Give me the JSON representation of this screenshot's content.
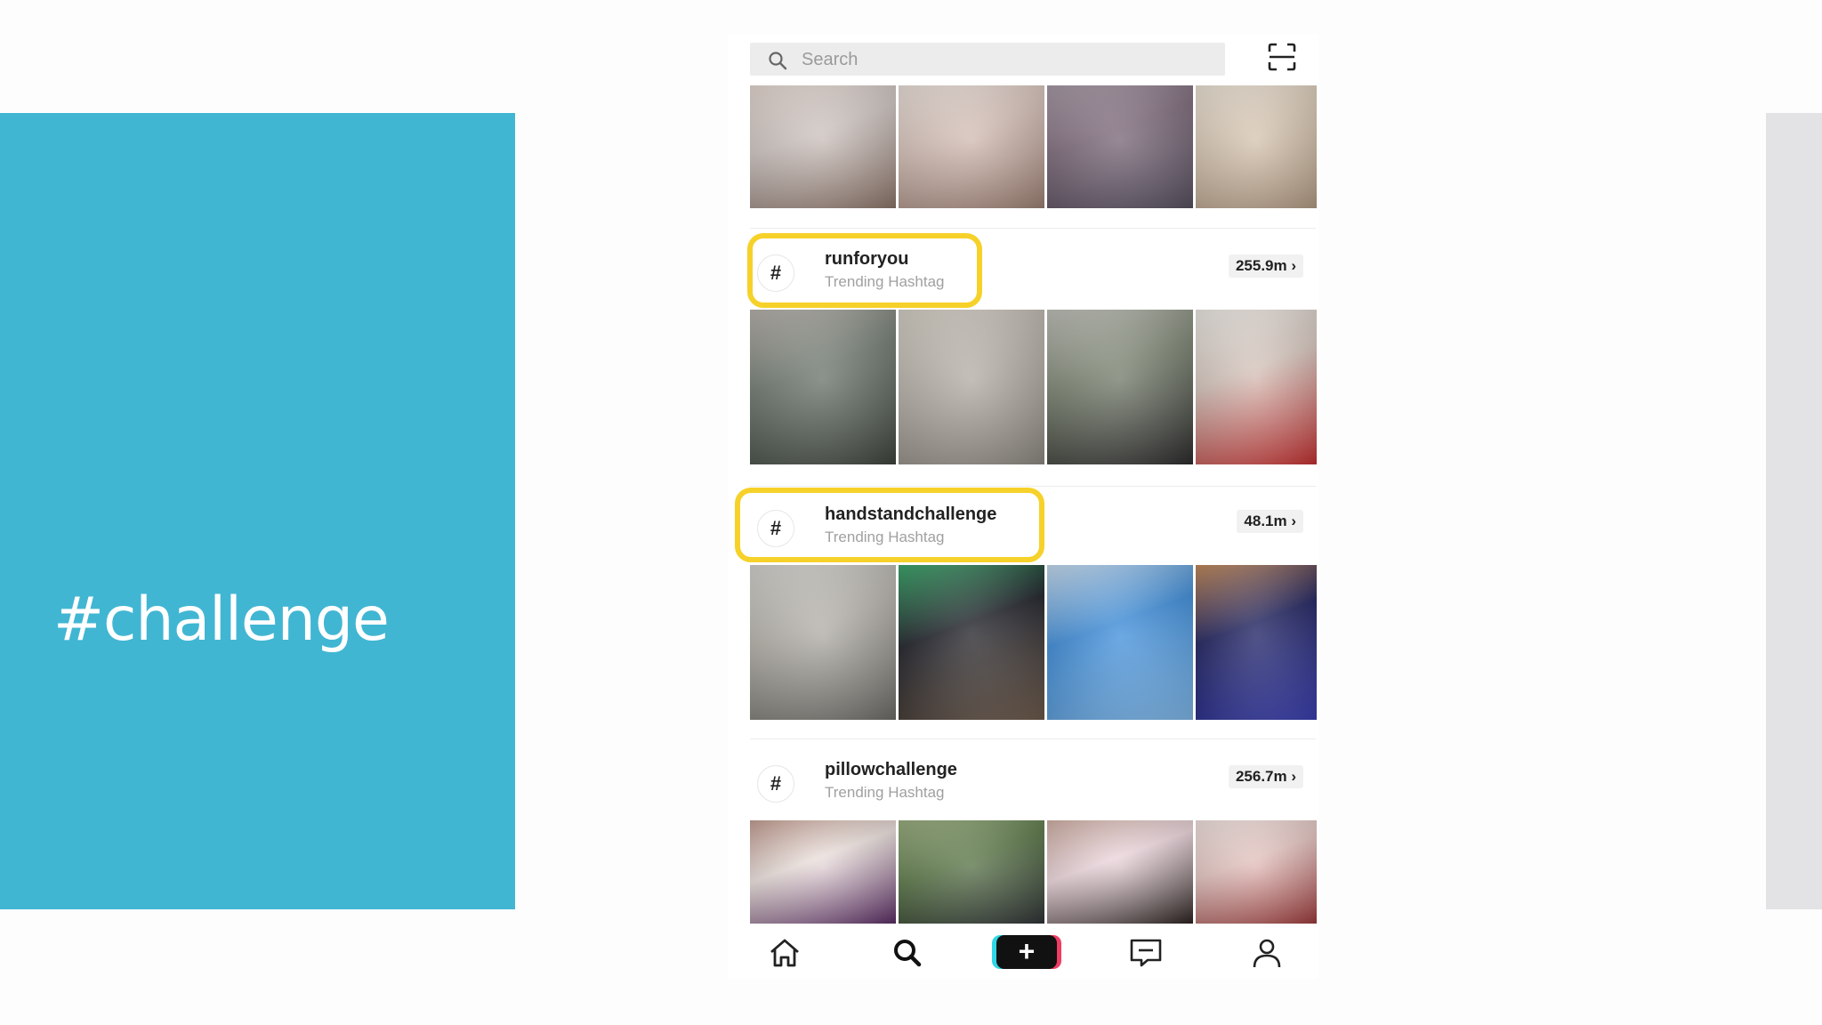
{
  "slide": {
    "title": "#challenge",
    "accent_color": "#41b6d3"
  },
  "app": {
    "search": {
      "placeholder": "Search",
      "icon": "search-icon"
    },
    "scan_icon": "scan-icon",
    "top_thumbnails": [
      {
        "colors": [
          "#cfc6c2",
          "#8b7468",
          "#e9dcd4"
        ]
      },
      {
        "colors": [
          "#d6c1b8",
          "#9c7f72",
          "#efe4dd"
        ]
      },
      {
        "colors": [
          "#7d6a7a",
          "#56505f",
          "#a89aa6"
        ]
      },
      {
        "colors": [
          "#d9c8b4",
          "#b29b83",
          "#efe6d8"
        ]
      }
    ],
    "hashtags": [
      {
        "name": "runforyou",
        "subtitle": "Trending Hashtag",
        "count": "255.9m ›",
        "highlighted": true,
        "thumbnails": [
          {
            "colors": [
              "#6f7a70",
              "#3e433d",
              "#b9b4ad"
            ]
          },
          {
            "colors": [
              "#b7b1a8",
              "#8c8880",
              "#d7d2c8"
            ]
          },
          {
            "colors": [
              "#7b8471",
              "#2c2b2c",
              "#c2c3bb"
            ]
          },
          {
            "colors": [
              "#d6c6bd",
              "#c32f2f",
              "#f0ede8"
            ]
          }
        ]
      },
      {
        "name": "handstandchallenge",
        "subtitle": "Trending Hashtag",
        "count": "48.1m ›",
        "highlighted": true,
        "thumbnails": [
          {
            "colors": [
              "#b5b2aa",
              "#6d6b66",
              "#d8d6d1"
            ]
          },
          {
            "colors": [
              "#1c1e26",
              "#6d5a4a",
              "#3aa86b"
            ]
          },
          {
            "colors": [
              "#3b8bd8",
              "#7fb7e8",
              "#c9dff3"
            ]
          },
          {
            "colors": [
              "#1c1f5c",
              "#3a3fb0",
              "#c48a5a"
            ]
          }
        ]
      },
      {
        "name": "pillowchallenge",
        "subtitle": "Trending Hashtag",
        "count": "256.7m ›",
        "highlighted": false,
        "thumbnails": [
          {
            "colors": [
              "#efe4e0",
              "#5a2c64",
              "#c7a093"
            ]
          },
          {
            "colors": [
              "#5d7a4a",
              "#2f3336",
              "#9bb07f"
            ]
          },
          {
            "colors": [
              "#efd9df",
              "#2b2220",
              "#d3b2a6"
            ]
          },
          {
            "colors": [
              "#e6c6c2",
              "#9d3a3a",
              "#f4e6e2"
            ]
          }
        ]
      }
    ],
    "bottom_nav": [
      {
        "icon": "home-icon"
      },
      {
        "icon": "discover-icon"
      },
      {
        "icon": "create-icon",
        "label": "+"
      },
      {
        "icon": "inbox-icon"
      },
      {
        "icon": "profile-icon"
      }
    ]
  }
}
